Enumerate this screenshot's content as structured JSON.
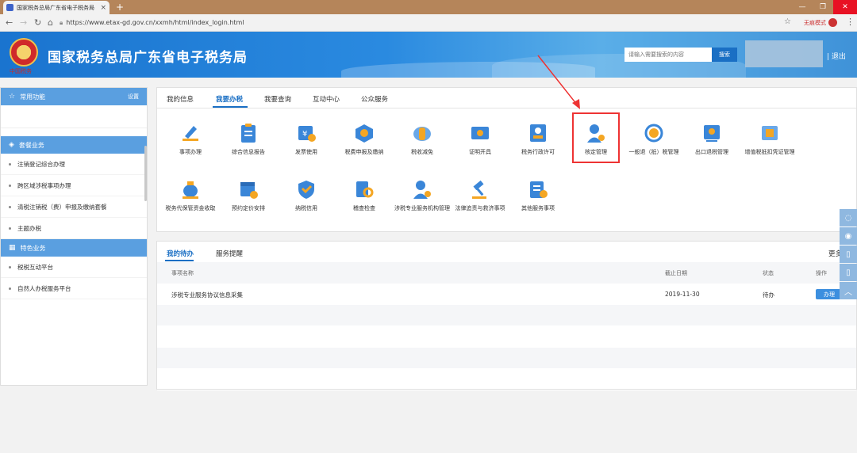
{
  "browser": {
    "tab_title": "国家税务总局广东省电子税务局",
    "tab_close": "×",
    "new_tab": "+",
    "url": "https://www.etax-gd.gov.cn/xxmh/html/index_login.html",
    "incognito_label": "无痕模式",
    "window_min": "—",
    "window_restore": "❐",
    "window_close": "✕"
  },
  "header": {
    "emblem_sub": "中国税务",
    "title": "国家税务总局广东省电子税务局",
    "search_placeholder": "请输入需要搜索的内容",
    "search_button": "搜索",
    "logout": "| 退出"
  },
  "sidebar": {
    "common_title": "常用功能",
    "common_setting": "设置",
    "package_title": "套餐业务",
    "package_items": [
      "注销登记综合办理",
      "跨区域涉税事项办理",
      "清税注销税（费）申报及缴纳套餐",
      "主题办税"
    ],
    "special_title": "特色业务",
    "special_items": [
      "税税互动平台",
      "自然人办税服务平台"
    ]
  },
  "main": {
    "tabs": [
      "我的信息",
      "我要办税",
      "我要查询",
      "互动中心",
      "公众服务"
    ],
    "active_tab": 1,
    "tiles": [
      {
        "label": "事项办理",
        "icon": "pencil-icon"
      },
      {
        "label": "综合信息报告",
        "icon": "clipboard-icon"
      },
      {
        "label": "发票使用",
        "icon": "invoice-icon"
      },
      {
        "label": "税费申报及缴纳",
        "icon": "box-icon"
      },
      {
        "label": "税收减免",
        "icon": "coins-icon"
      },
      {
        "label": "证明开具",
        "icon": "ticket-icon"
      },
      {
        "label": "税务行政许可",
        "icon": "id-card-icon"
      },
      {
        "label": "核定管理",
        "icon": "user-gear-icon"
      },
      {
        "label": "一般退（抵）税管理",
        "icon": "refund-icon"
      },
      {
        "label": "出口退税管理",
        "icon": "export-icon"
      },
      {
        "label": "增值税抵扣凭证管理",
        "icon": "voucher-icon"
      },
      {
        "label": "税务代保管资金收取",
        "icon": "money-bag-icon"
      },
      {
        "label": "预约定价安排",
        "icon": "calendar-icon"
      },
      {
        "label": "纳税信用",
        "icon": "shield-icon"
      },
      {
        "label": "稽查检查",
        "icon": "search-doc-icon"
      },
      {
        "label": "涉税专业服务机构管理",
        "icon": "user-gear-icon"
      },
      {
        "label": "法律追责与救济事项",
        "icon": "gavel-icon"
      },
      {
        "label": "其他服务事项",
        "icon": "list-add-icon"
      }
    ]
  },
  "todo": {
    "tabs": [
      "我的待办",
      "服务提醒"
    ],
    "more": "更多",
    "columns": [
      "事项名称",
      "截止日期",
      "状态",
      "操作"
    ],
    "rows": [
      {
        "name": "涉税专业服务协议信息采集",
        "deadline": "2019-11-30",
        "status": "待办",
        "action": "办理"
      }
    ]
  },
  "colors": {
    "brand": "#1a6fc4",
    "sidebar_head": "#5a9fe0",
    "highlight": "#e33333"
  }
}
